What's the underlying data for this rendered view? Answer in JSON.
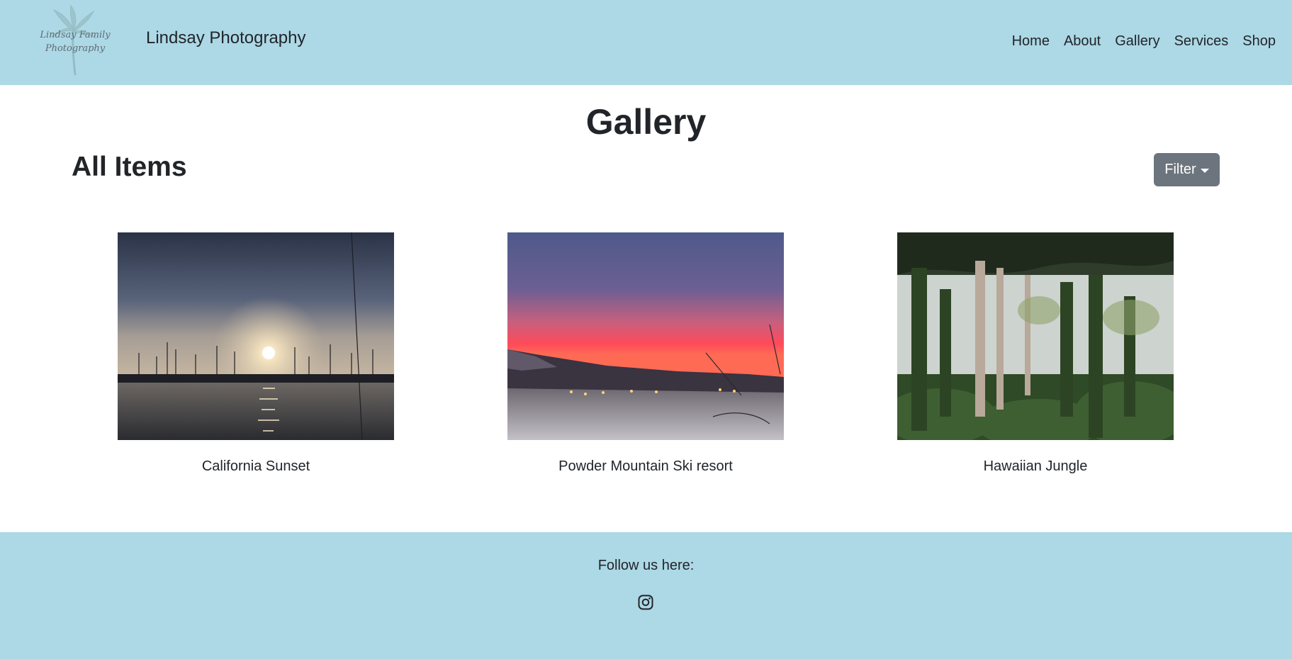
{
  "header": {
    "logo_text": "Lindsay Family\nPhotography",
    "brand": "Lindsay Photography",
    "nav": [
      "Home",
      "About",
      "Gallery",
      "Services",
      "Shop"
    ]
  },
  "main": {
    "title": "Gallery",
    "section_title": "All Items",
    "filter_label": "Filter",
    "items": [
      {
        "caption": "California Sunset",
        "image": "harbor-sunset-photo"
      },
      {
        "caption": "Powder Mountain Ski resort",
        "image": "mountain-sunset-snow-photo"
      },
      {
        "caption": "Hawaiian Jungle",
        "image": "jungle-trees-photo"
      }
    ]
  },
  "footer": {
    "follow_text": "Follow us here:",
    "social_icon": "instagram-icon"
  },
  "colors": {
    "header_bg": "#add8e6",
    "footer_bg": "#add8e6",
    "button_bg": "#6c757d",
    "text": "#212529"
  }
}
